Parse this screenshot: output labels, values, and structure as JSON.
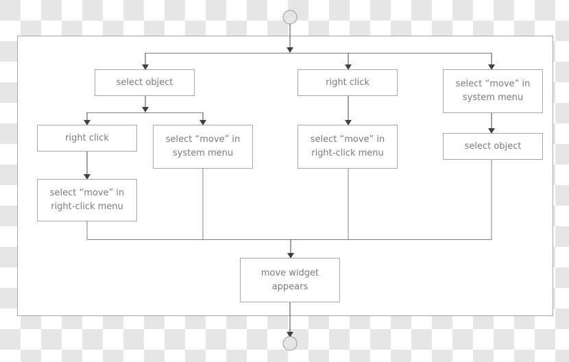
{
  "diagram": {
    "type": "flowchart",
    "colors": {
      "line": "#7f7f7f",
      "arrow": "#404040",
      "box_border": "#a6a6a6",
      "text": "#7a7a7a",
      "terminal_fill": "#e6e6e6"
    },
    "start": {
      "label": ""
    },
    "end": {
      "label": ""
    },
    "nodes": [
      {
        "id": "select-object-left",
        "label": "select object"
      },
      {
        "id": "right-click-left",
        "label": "right click"
      },
      {
        "id": "select-move-system-left",
        "label": "select “move” in\nsystem menu"
      },
      {
        "id": "select-move-rightclick-left",
        "label": "select “move” in\nright-click menu"
      },
      {
        "id": "right-click-middle",
        "label": "right click"
      },
      {
        "id": "select-move-rightclick-middle",
        "label": "select “move” in\nright-click menu"
      },
      {
        "id": "select-move-system-right",
        "label": "select “move” in\nsystem menu"
      },
      {
        "id": "select-object-right",
        "label": "select object"
      },
      {
        "id": "move-widget-appears",
        "label": "move widget\nappears"
      }
    ],
    "edges": [
      [
        "start",
        "select-object-left"
      ],
      [
        "start",
        "right-click-middle"
      ],
      [
        "start",
        "select-move-system-right"
      ],
      [
        "select-object-left",
        "right-click-left"
      ],
      [
        "select-object-left",
        "select-move-system-left"
      ],
      [
        "right-click-left",
        "select-move-rightclick-left"
      ],
      [
        "right-click-middle",
        "select-move-rightclick-middle"
      ],
      [
        "select-move-system-right",
        "select-object-right"
      ],
      [
        "select-move-rightclick-left",
        "move-widget-appears"
      ],
      [
        "select-move-system-left",
        "move-widget-appears"
      ],
      [
        "select-move-rightclick-middle",
        "move-widget-appears"
      ],
      [
        "select-object-right",
        "move-widget-appears"
      ],
      [
        "move-widget-appears",
        "end"
      ]
    ]
  }
}
